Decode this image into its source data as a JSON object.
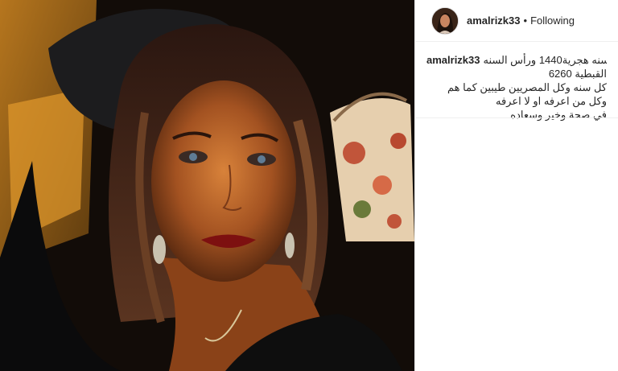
{
  "post": {
    "username": "amalrizk33",
    "separator": "•",
    "follow_status": "Following"
  },
  "caption": {
    "username": "amalrizk33",
    "lines": [
      "بداية سنه هجرية1440 ورأس السنه",
      "القبطية 6260",
      "كل سنه وكل المصريين طيبين كما هم",
      "وكل من اعرفه او لا اعرفه",
      "في صحة وخير وسعاده"
    ]
  },
  "photo": {
    "subject": "selfie-photo"
  }
}
